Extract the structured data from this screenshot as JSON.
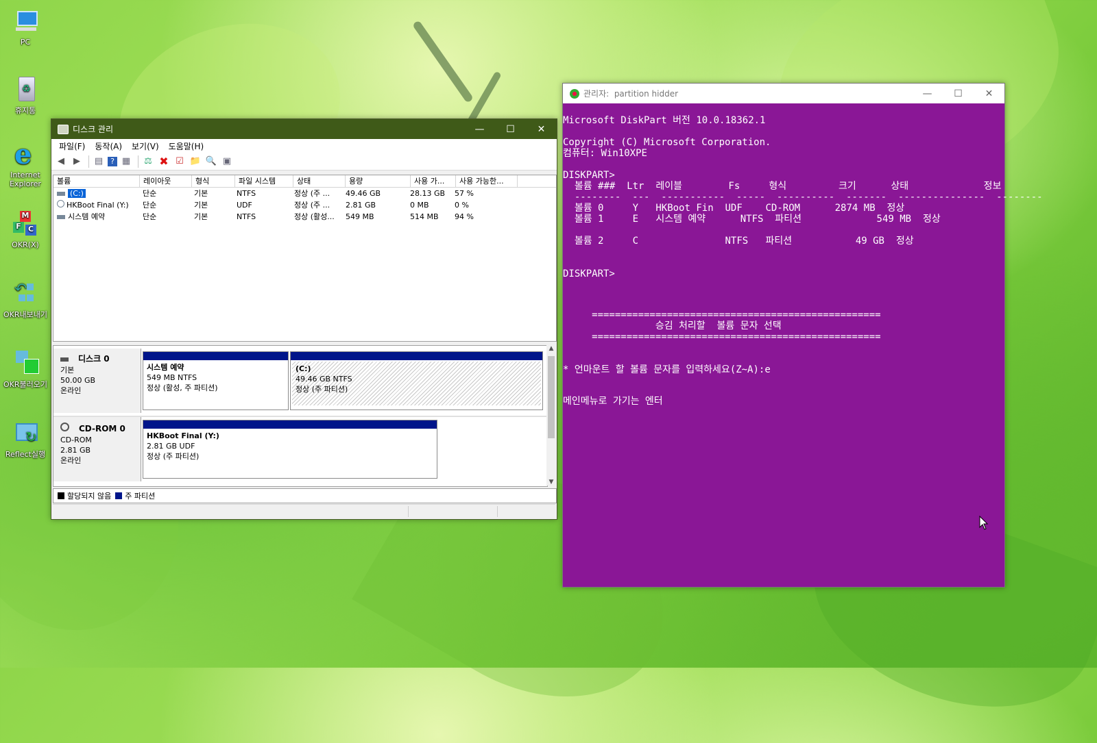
{
  "desktop": {
    "icons": [
      {
        "label": "PC"
      },
      {
        "label": "휴지통"
      },
      {
        "label": "Internet Explorer"
      },
      {
        "label": "OKR(X)"
      },
      {
        "label": "OKR내보내기"
      },
      {
        "label": "OKR불러오기"
      },
      {
        "label": "Reflect실행"
      }
    ]
  },
  "disk_mgmt": {
    "title": "디스크 관리",
    "menu": [
      "파일(F)",
      "동작(A)",
      "보기(V)",
      "도움말(H)"
    ],
    "columns": [
      "볼륨",
      "레이아웃",
      "형식",
      "파일 시스템",
      "상태",
      "용량",
      "사용 가...",
      "사용 가능한..."
    ],
    "volumes": [
      {
        "name": "(C:)",
        "layout": "단순",
        "type": "기본",
        "fs": "NTFS",
        "status": "정상 (주 ...",
        "capacity": "49.46 GB",
        "free": "28.13 GB",
        "pct": "57 %"
      },
      {
        "name": "HKBoot Final (Y:)",
        "layout": "단순",
        "type": "기본",
        "fs": "UDF",
        "status": "정상 (주 ...",
        "capacity": "2.81 GB",
        "free": "0 MB",
        "pct": "0 %"
      },
      {
        "name": "시스템 예약",
        "layout": "단순",
        "type": "기본",
        "fs": "NTFS",
        "status": "정상 (활성...",
        "capacity": "549 MB",
        "free": "514 MB",
        "pct": "94 %"
      }
    ],
    "disks": [
      {
        "name": "디스크 0",
        "kind": "기본",
        "size": "50.00 GB",
        "state": "온라인",
        "parts": [
          {
            "name": "시스템 예약",
            "size": "549 MB NTFS",
            "status": "정상 (활성, 주 파티션)"
          },
          {
            "name": "(C:)",
            "size": "49.46 GB NTFS",
            "status": "정상 (주 파티션)"
          }
        ]
      },
      {
        "name": "CD-ROM 0",
        "kind": "CD-ROM",
        "size": "2.81 GB",
        "state": "온라인",
        "parts": [
          {
            "name": "HKBoot Final  (Y:)",
            "size": "2.81 GB UDF",
            "status": "정상 (주 파티션)"
          }
        ]
      }
    ],
    "legend": [
      "할당되지 않음",
      "주 파티션"
    ],
    "colors": {
      "primary_partition": "#00158a",
      "unallocated": "#000000",
      "titlebar": "#3f5a18"
    }
  },
  "console": {
    "title_prefix": "관리자:",
    "title": "partition hidder",
    "background": "#8a1796",
    "lines": [
      "Microsoft DiskPart 버전 10.0.18362.1",
      "",
      "Copyright (C) Microsoft Corporation.",
      "컴퓨터: Win10XPE",
      "",
      "DISKPART>",
      "  볼륨 ###  Ltr  레이블        Fs     형식         크기      상태             정보",
      "  --------  ---  -----------  -----  ----------  -------  ---------------  --------",
      "  볼륨 0     Y   HKBoot Fin  UDF    CD-ROM      2874 MB  정상",
      "  볼륨 1     E   시스템 예약      NTFS  파티션             549 MB  정상",
      "",
      "  볼륨 2     C               NTFS   파티션           49 GB  정상",
      "",
      "",
      "DISKPART>",
      "",
      "",
      "",
      "     ==================================================",
      "                승김 처리할  볼륨 문자 선택",
      "     ==================================================",
      "",
      "",
      "* 언마운트 할 볼륨 문자를 입력하세요(Z~A):e",
      "",
      "",
      "메인메뉴로 가기는 엔터"
    ]
  }
}
